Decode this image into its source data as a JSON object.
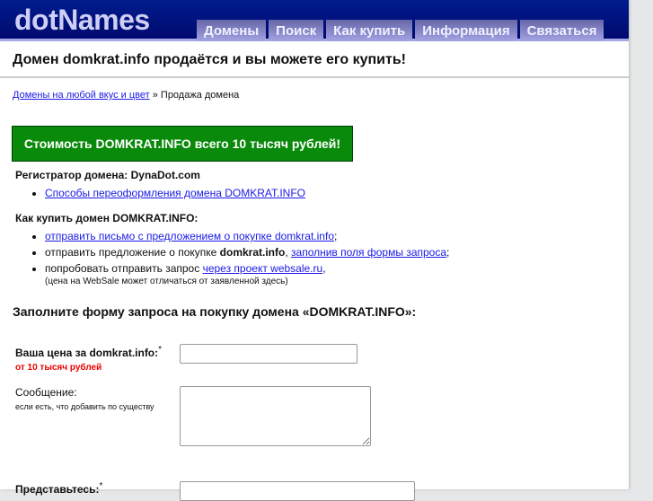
{
  "header": {
    "logo": "dotNames",
    "nav": [
      "Домены",
      "Поиск",
      "Как купить",
      "Информация",
      "Связаться"
    ]
  },
  "title": "Домен domkrat.info продаётся и вы можете его купить!",
  "breadcrumb": {
    "link": "Домены на любой вкус и цвет",
    "sep": " » ",
    "current": "Продажа домена"
  },
  "price_banner": "Стоимость DOMKRAT.INFO всего 10 тысяч рублей!",
  "registrar": {
    "heading": "Регистратор домена: DynaDot.com",
    "link": "Способы переоформления домена DOMKRAT.INFO"
  },
  "howto": {
    "heading": "Как купить домен DOMKRAT.INFO:",
    "item1_link": "отправить письмо с предложением о покупке domkrat.info",
    "item1_end": ";",
    "item2_text": "отправить предложение о покупке ",
    "item2_bold": "domkrat.info",
    "item2_comma": ", ",
    "item2_link": "заполнив поля формы запроса",
    "item2_end": ";",
    "item3_text": "попробовать отправить запрос ",
    "item3_link": "через проект websale.ru",
    "item3_end": ",",
    "item3_note": "(цена на WebSale может отличаться от заявленной здесь)"
  },
  "form": {
    "title": "Заполните форму запроса на покупку домена «DOMKRAT.INFO»:",
    "price_label": "Ваша цена за domkrat.info:",
    "required": "*",
    "price_hint": "от 10 тысяч рублей",
    "price_value": "",
    "message_label": "Сообщение:",
    "message_hint": "если есть, что добавить по существу",
    "message_value": "",
    "name_label": "Представьтесь:"
  }
}
